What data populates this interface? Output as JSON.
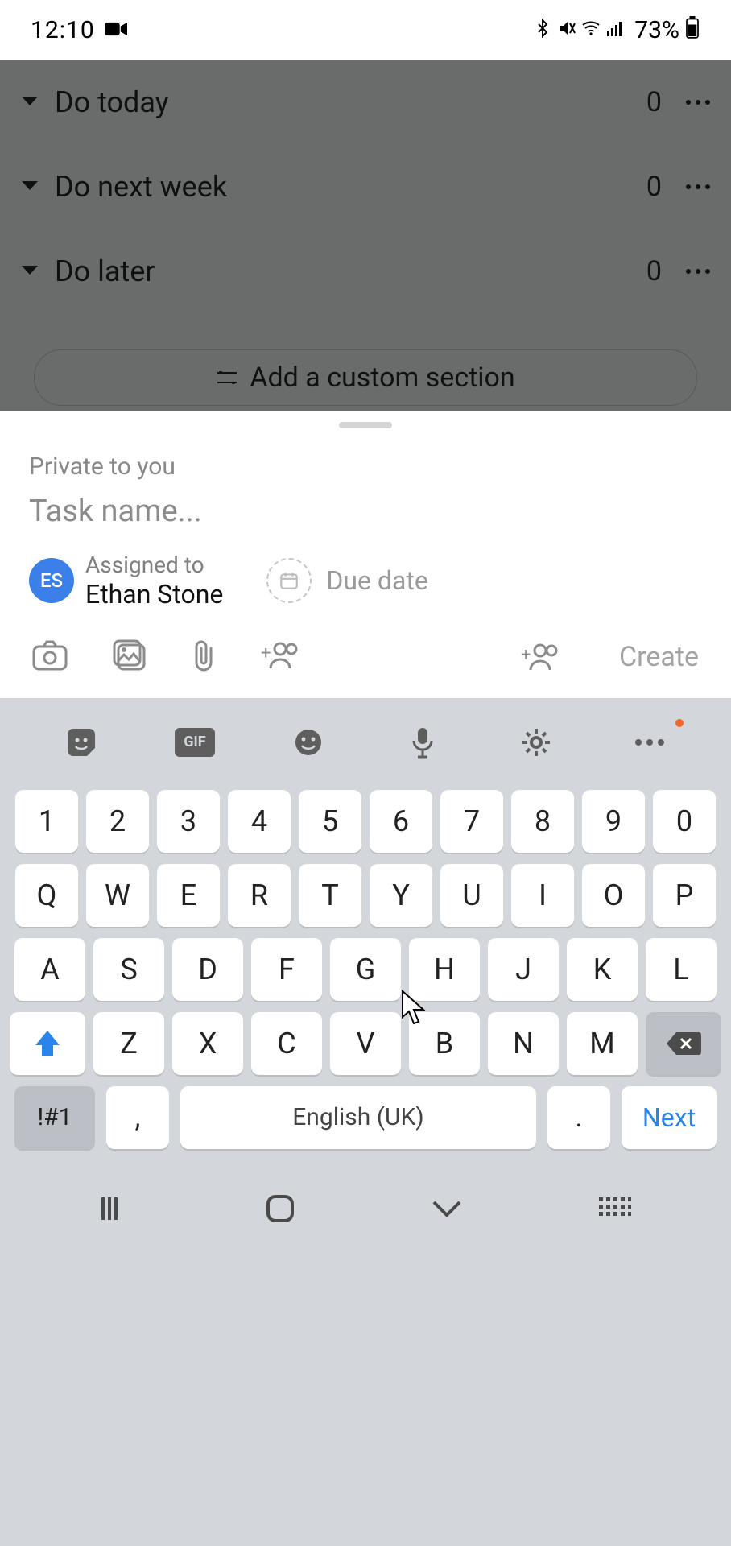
{
  "status_bar": {
    "time": "12:10",
    "battery_pct": "73%"
  },
  "background": {
    "sections": [
      {
        "title": "Do today",
        "count": "0"
      },
      {
        "title": "Do next week",
        "count": "0"
      },
      {
        "title": "Do later",
        "count": "0"
      }
    ],
    "add_custom_label": "Add a custom section"
  },
  "sheet": {
    "privacy": "Private to you",
    "task_placeholder": "Task name...",
    "assignee_label": "Assigned to",
    "assignee_name": "Ethan Stone",
    "assignee_initials": "ES",
    "due_date_label": "Due date",
    "create_label": "Create"
  },
  "keyboard": {
    "space_label": "English (UK)",
    "next_label": "Next",
    "symbols_label": "!#1",
    "rows": {
      "numbers": [
        "1",
        "2",
        "3",
        "4",
        "5",
        "6",
        "7",
        "8",
        "9",
        "0"
      ],
      "r1": [
        "Q",
        "W",
        "E",
        "R",
        "T",
        "Y",
        "U",
        "I",
        "O",
        "P"
      ],
      "r2": [
        "A",
        "S",
        "D",
        "F",
        "G",
        "H",
        "J",
        "K",
        "L"
      ],
      "r3": [
        "Z",
        "X",
        "C",
        "V",
        "B",
        "N",
        "M"
      ]
    }
  }
}
